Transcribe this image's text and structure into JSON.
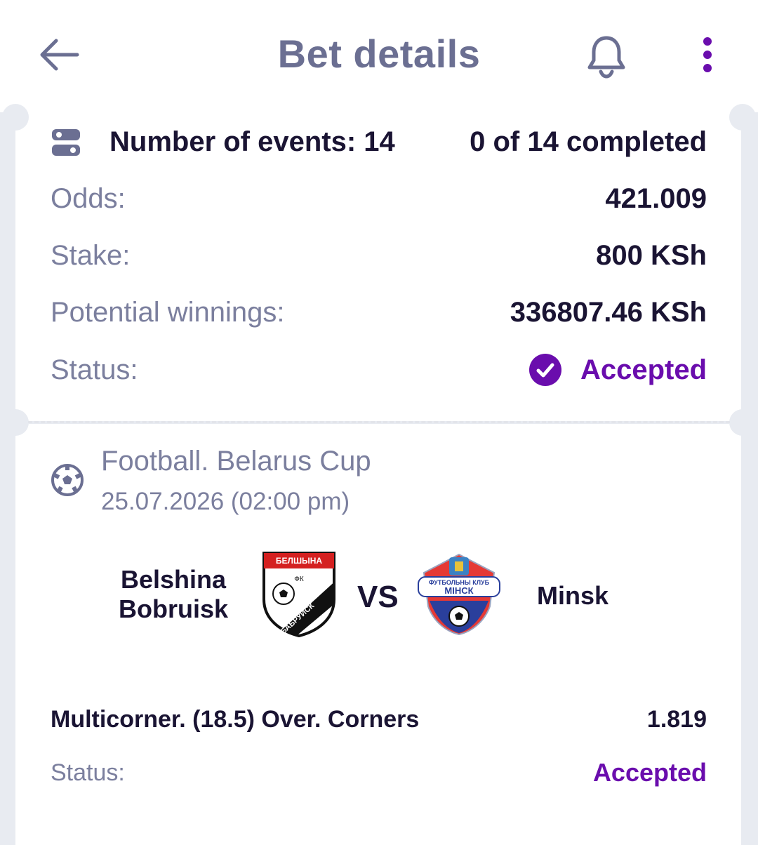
{
  "header": {
    "title": "Bet details"
  },
  "summary": {
    "events_label": "Number of events: 14",
    "completed": "0 of 14 completed",
    "odds_label": "Odds:",
    "odds_value": "421.009",
    "stake_label": "Stake:",
    "stake_value": "800 KSh",
    "winnings_label": "Potential winnings:",
    "winnings_value": "336807.46 KSh",
    "status_label": "Status:",
    "status_value": "Accepted"
  },
  "event": {
    "league": "Football. Belarus Cup",
    "date": "25.07.2026 (02:00 pm)",
    "team1": "Belshina Bobruisk",
    "team2": "Minsk",
    "vs": "VS",
    "team1_logo_text_top": "БЕЛШЫНА",
    "team1_logo_text_mid": "ФК",
    "team1_logo_text_diag": "БАБРУЙСК",
    "team2_logo_text_top": "ФУТБОЛЬНЫ КЛУБ",
    "team2_logo_text_main": "МІНСК",
    "market": "Multicorner. (18.5) Over. Corners",
    "market_odds": "1.819",
    "market_status_label": "Status:",
    "market_status_value": "Accepted"
  },
  "icons": {
    "back": "arrow-left-icon",
    "bell": "bell-icon",
    "more": "more-vertical-icon",
    "events": "toggle-list-icon",
    "check": "check-circle-icon",
    "sport": "football-icon"
  },
  "colors": {
    "accent": "#6a0dad",
    "text_dark": "#1a1433",
    "text_muted": "#7b7f9e",
    "header_title": "#6b6f92",
    "background": "#e8ebf1"
  }
}
